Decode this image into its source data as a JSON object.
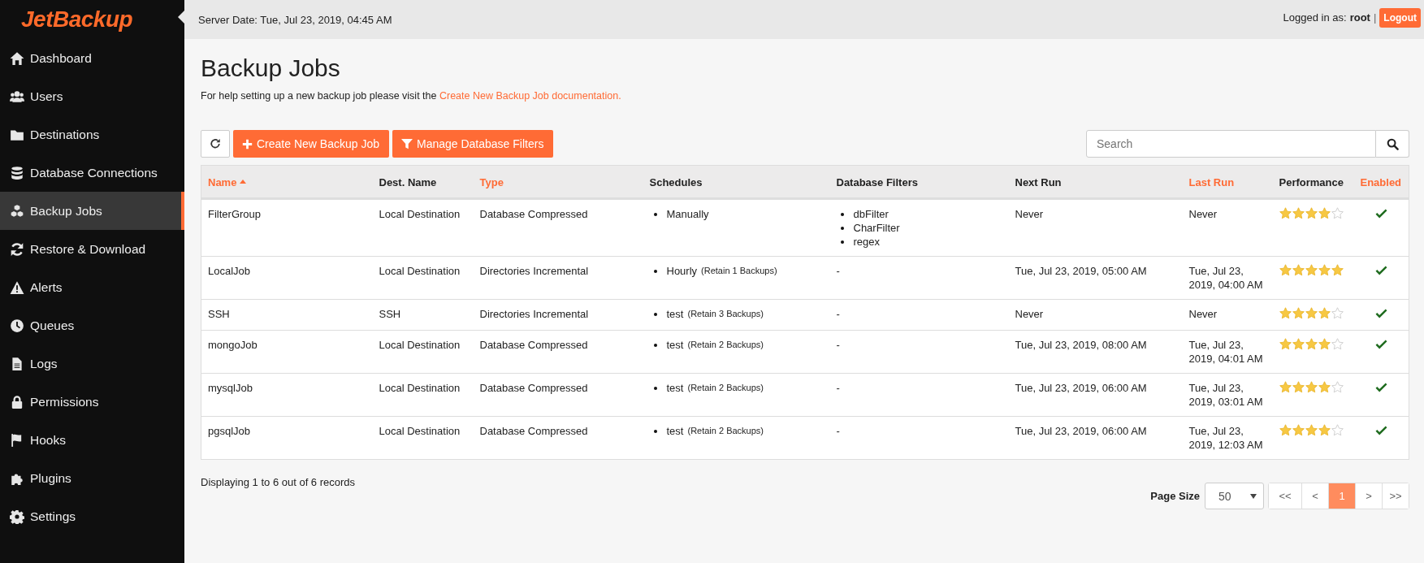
{
  "logo": "JetBackup",
  "sidebar": {
    "items": [
      {
        "label": "Dashboard",
        "selected": false
      },
      {
        "label": "Users",
        "selected": false
      },
      {
        "label": "Destinations",
        "selected": false
      },
      {
        "label": "Database Connections",
        "selected": false
      },
      {
        "label": "Backup Jobs",
        "selected": true
      },
      {
        "label": "Restore & Download",
        "selected": false
      },
      {
        "label": "Alerts",
        "selected": false
      },
      {
        "label": "Queues",
        "selected": false
      },
      {
        "label": "Logs",
        "selected": false
      },
      {
        "label": "Permissions",
        "selected": false
      },
      {
        "label": "Hooks",
        "selected": false
      },
      {
        "label": "Plugins",
        "selected": false
      },
      {
        "label": "Settings",
        "selected": false
      }
    ]
  },
  "header": {
    "server_date": "Server Date: Tue, Jul 23, 2019, 04:45 AM",
    "user_label": "Logged in as:",
    "user": "root",
    "separator": "|",
    "logout": "Logout"
  },
  "page": {
    "title": "Backup Jobs",
    "help_text": "For help setting up a new backup job please visit the",
    "help_link": "Create New Backup Job documentation."
  },
  "toolbar": {
    "create": "Create New Backup Job",
    "filters": "Manage Database Filters",
    "search": {
      "placeholder": "Search"
    }
  },
  "table": {
    "columns": [
      {
        "label": "Name",
        "sortable": true,
        "sorted": true
      },
      {
        "label": "Dest. Name",
        "sortable": false,
        "sorted": false
      },
      {
        "label": "Type",
        "sortable": true,
        "sorted": false
      },
      {
        "label": "Schedules",
        "sortable": false,
        "sorted": false
      },
      {
        "label": "Database Filters",
        "sortable": false,
        "sorted": false
      },
      {
        "label": "Next Run",
        "sortable": false,
        "sorted": false
      },
      {
        "label": "Last Run",
        "sortable": true,
        "sorted": false
      },
      {
        "label": "Performance",
        "sortable": false,
        "sorted": false
      },
      {
        "label": "Enabled",
        "sortable": true,
        "sorted": false
      }
    ],
    "rows": [
      {
        "name": "FilterGroup",
        "dest": "Local Destination",
        "type": "Database Compressed",
        "schedules": [
          {
            "name": "Manually"
          }
        ],
        "filters": [
          "dbFilter",
          "CharFilter",
          "regex"
        ],
        "next_run": "Never",
        "last_run": "Never",
        "stars": 4,
        "enabled": true
      },
      {
        "name": "LocalJob",
        "dest": "Local Destination",
        "type": "Directories Incremental",
        "schedules": [
          {
            "name": "Hourly",
            "retain": "(Retain 1 Backups)"
          }
        ],
        "filters_text": "-",
        "next_run": "Tue, Jul 23, 2019, 05:00 AM",
        "last_run": "Tue, Jul 23, 2019, 04:00 AM",
        "stars": 5,
        "enabled": true
      },
      {
        "name": "SSH",
        "dest": "SSH",
        "type": "Directories Incremental",
        "schedules": [
          {
            "name": "test",
            "retain": "(Retain 3 Backups)"
          }
        ],
        "filters_text": "-",
        "next_run": "Never",
        "last_run": "Never",
        "stars": 4,
        "enabled": true
      },
      {
        "name": "mongoJob",
        "dest": "Local Destination",
        "type": "Database Compressed",
        "schedules": [
          {
            "name": "test",
            "retain": "(Retain 2 Backups)"
          }
        ],
        "filters_text": "-",
        "next_run": "Tue, Jul 23, 2019, 08:00 AM",
        "last_run": "Tue, Jul 23, 2019, 04:01 AM",
        "stars": 4,
        "enabled": true
      },
      {
        "name": "mysqlJob",
        "dest": "Local Destination",
        "type": "Database Compressed",
        "schedules": [
          {
            "name": "test",
            "retain": "(Retain 2 Backups)"
          }
        ],
        "filters_text": "-",
        "next_run": "Tue, Jul 23, 2019, 06:00 AM",
        "last_run": "Tue, Jul 23, 2019, 03:01 AM",
        "stars": 4,
        "enabled": true
      },
      {
        "name": "pgsqlJob",
        "dest": "Local Destination",
        "type": "Database Compressed",
        "schedules": [
          {
            "name": "test",
            "retain": "(Retain 2 Backups)"
          }
        ],
        "filters_text": "-",
        "next_run": "Tue, Jul 23, 2019, 06:00 AM",
        "last_run": "Tue, Jul 23, 2019, 12:03 AM",
        "stars": 4,
        "enabled": true
      }
    ]
  },
  "footer": {
    "records": "Displaying 1 to 6 out of 6 records",
    "page_size_label": "Page Size",
    "page_size": "50",
    "pages": [
      {
        "label": "<<",
        "selected": false
      },
      {
        "label": "<",
        "selected": false
      },
      {
        "label": "1",
        "selected": true
      },
      {
        "label": ">",
        "selected": false
      },
      {
        "label": ">>",
        "selected": false
      }
    ]
  }
}
